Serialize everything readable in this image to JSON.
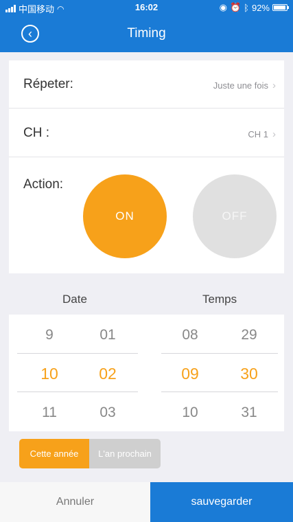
{
  "status_bar": {
    "carrier": "中国移动",
    "time": "16:02",
    "battery": "92%",
    "battery_level": 0.92
  },
  "header": {
    "title": "Timing"
  },
  "settings": {
    "repeat": {
      "label": "Répeter:",
      "value": "Juste une fois"
    },
    "channel": {
      "label": "CH :",
      "value": "CH 1"
    },
    "action": {
      "label": "Action:",
      "on": "ON",
      "off": "OFF",
      "selected": "ON"
    }
  },
  "picker": {
    "date_header": "Date",
    "time_header": "Temps",
    "day": {
      "prev": "9",
      "selected": "10",
      "next": "11"
    },
    "month": {
      "prev": "01",
      "selected": "02",
      "next": "03"
    },
    "hour": {
      "prev": "08",
      "selected": "09",
      "next": "10"
    },
    "minute": {
      "prev": "29",
      "selected": "30",
      "next": "31"
    }
  },
  "year_toggle": {
    "this_year": "Cette année",
    "next_year": "L'an prochain",
    "selected": "this_year"
  },
  "footer": {
    "cancel": "Annuler",
    "save": "sauvegarder"
  },
  "colors": {
    "primary": "#1a7bd6",
    "accent": "#f7a11a",
    "inactive": "#e0e0e0"
  }
}
